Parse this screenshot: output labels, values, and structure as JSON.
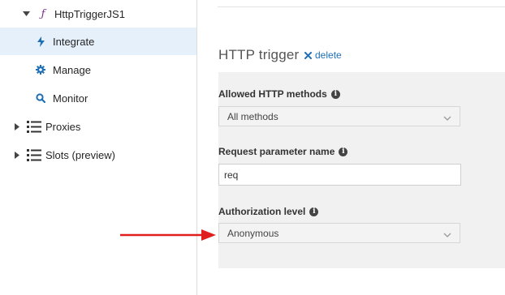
{
  "sidebar": {
    "function": {
      "label": "HttpTriggerJS1",
      "icon": "function-icon"
    },
    "items": [
      {
        "label": "Integrate",
        "icon": "lightning-icon",
        "selected": true
      },
      {
        "label": "Manage",
        "icon": "gear-icon",
        "selected": false
      },
      {
        "label": "Monitor",
        "icon": "search-icon",
        "selected": false
      }
    ],
    "groups": [
      {
        "label": "Proxies",
        "icon": "list-icon"
      },
      {
        "label": "Slots (preview)",
        "icon": "list-icon"
      }
    ]
  },
  "trigger": {
    "title": "HTTP trigger",
    "delete_label": "delete",
    "fields": {
      "methods": {
        "label": "Allowed HTTP methods",
        "value": "All methods"
      },
      "param": {
        "label": "Request parameter name",
        "value": "req"
      },
      "auth": {
        "label": "Authorization level",
        "value": "Anonymous"
      }
    }
  },
  "colors": {
    "selected_bg": "#e6f0fa",
    "accent_blue": "#1e6fb5",
    "function_purple": "#7a2f8e",
    "annotation_arrow": "#e01e1e"
  }
}
